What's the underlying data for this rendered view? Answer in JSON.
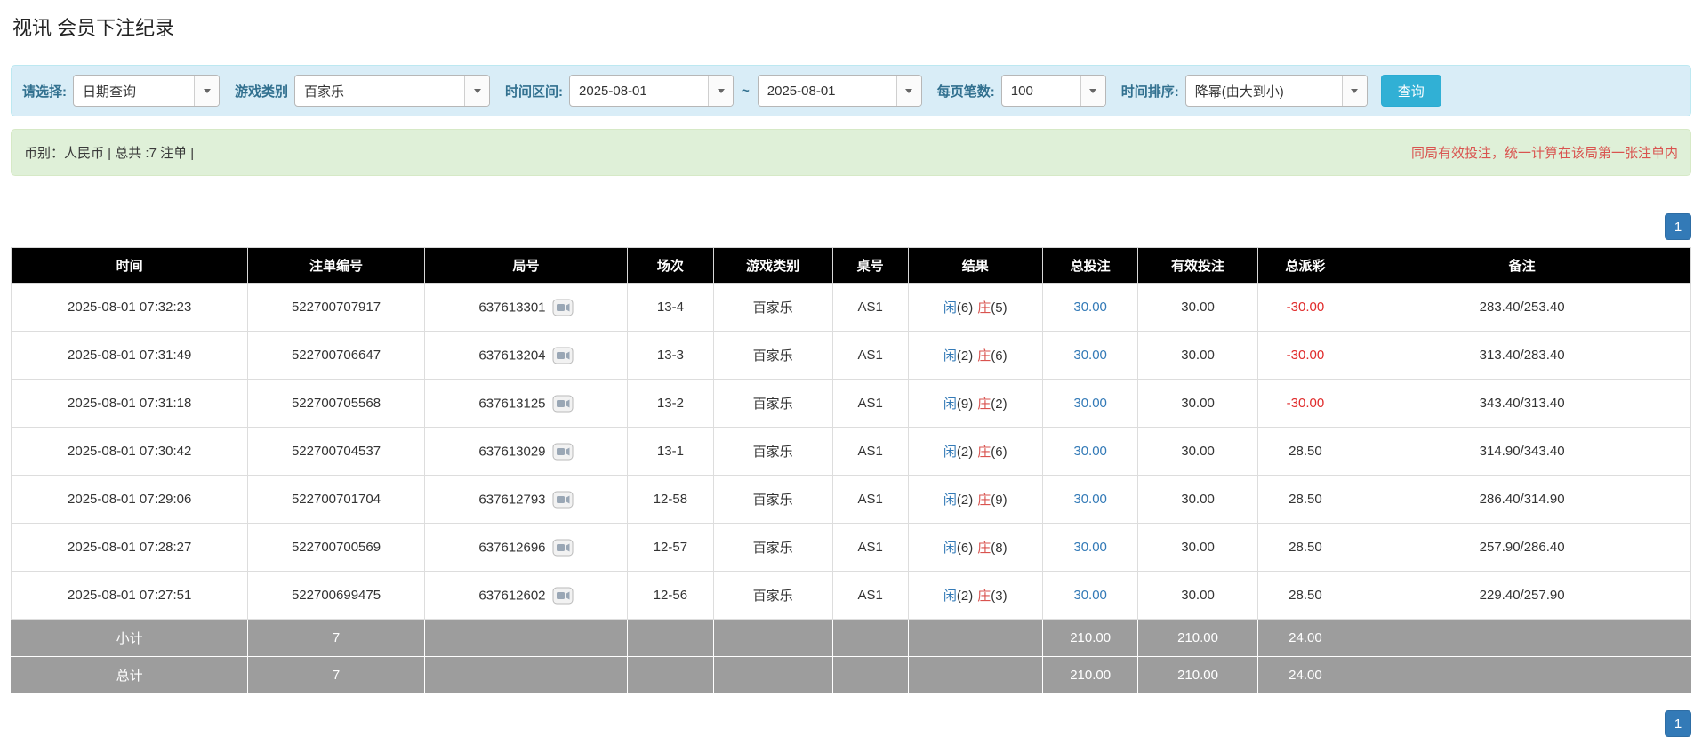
{
  "page": {
    "title": "视讯 会员下注纪录"
  },
  "colors": {
    "filter_bar_bg": "#d9edf7",
    "summary_bar_bg": "#dff0d8",
    "accent_blue": "#337ab7",
    "search_button_blue": "#31b0d5",
    "negative_red": "#e02b2b",
    "player_blue": "#337ab7",
    "banker_red": "#d9534f",
    "table_header_bg": "#000000",
    "total_row_bg": "#9d9d9d"
  },
  "icons": {
    "combo_caret": "caret-down",
    "round_replay": "video-replay"
  },
  "filters": {
    "select_label": "请选择:",
    "select_value": "日期查询",
    "game_label": "游戏类别",
    "game_value": "百家乐",
    "range_label": "时间区间:",
    "date_from": "2025-08-01",
    "range_separator": "~",
    "date_to": "2025-08-01",
    "page_size_label": "每页笔数:",
    "page_size_value": "100",
    "sort_label": "时间排序:",
    "sort_value": "降幂(由大到小)",
    "search_button": "查询"
  },
  "summary": {
    "left_text": "币别：人民币 | 总共 :7 注单 |",
    "right_text": "同局有效投注，统一计算在该局第一张注单内"
  },
  "pagination": {
    "current_page": "1"
  },
  "table": {
    "headers": [
      "时间",
      "注单编号",
      "局号",
      "场次",
      "游戏类别",
      "桌号",
      "结果",
      "总投注",
      "有效投注",
      "总派彩",
      "备注"
    ],
    "rows": [
      {
        "time": "2025-08-01 07:32:23",
        "bet_no": "522700707917",
        "round_no": "637613301",
        "session": "13-4",
        "game": "百家乐",
        "table_no": "AS1",
        "player_label": "闲",
        "player_value": "(6)",
        "banker_label": "庄",
        "banker_value": "(5)",
        "total_bet": "30.00",
        "valid_bet": "30.00",
        "payout": "-30.00",
        "note": "283.40/253.40"
      },
      {
        "time": "2025-08-01 07:31:49",
        "bet_no": "522700706647",
        "round_no": "637613204",
        "session": "13-3",
        "game": "百家乐",
        "table_no": "AS1",
        "player_label": "闲",
        "player_value": "(2)",
        "banker_label": "庄",
        "banker_value": "(6)",
        "total_bet": "30.00",
        "valid_bet": "30.00",
        "payout": "-30.00",
        "note": "313.40/283.40"
      },
      {
        "time": "2025-08-01 07:31:18",
        "bet_no": "522700705568",
        "round_no": "637613125",
        "session": "13-2",
        "game": "百家乐",
        "table_no": "AS1",
        "player_label": "闲",
        "player_value": "(9)",
        "banker_label": "庄",
        "banker_value": "(2)",
        "total_bet": "30.00",
        "valid_bet": "30.00",
        "payout": "-30.00",
        "note": "343.40/313.40"
      },
      {
        "time": "2025-08-01 07:30:42",
        "bet_no": "522700704537",
        "round_no": "637613029",
        "session": "13-1",
        "game": "百家乐",
        "table_no": "AS1",
        "player_label": "闲",
        "player_value": "(2)",
        "banker_label": "庄",
        "banker_value": "(6)",
        "total_bet": "30.00",
        "valid_bet": "30.00",
        "payout": "28.50",
        "note": "314.90/343.40"
      },
      {
        "time": "2025-08-01 07:29:06",
        "bet_no": "522700701704",
        "round_no": "637612793",
        "session": "12-58",
        "game": "百家乐",
        "table_no": "AS1",
        "player_label": "闲",
        "player_value": "(2)",
        "banker_label": "庄",
        "banker_value": "(9)",
        "total_bet": "30.00",
        "valid_bet": "30.00",
        "payout": "28.50",
        "note": "286.40/314.90"
      },
      {
        "time": "2025-08-01 07:28:27",
        "bet_no": "522700700569",
        "round_no": "637612696",
        "session": "12-57",
        "game": "百家乐",
        "table_no": "AS1",
        "player_label": "闲",
        "player_value": "(6)",
        "banker_label": "庄",
        "banker_value": "(8)",
        "total_bet": "30.00",
        "valid_bet": "30.00",
        "payout": "28.50",
        "note": "257.90/286.40"
      },
      {
        "time": "2025-08-01 07:27:51",
        "bet_no": "522700699475",
        "round_no": "637612602",
        "session": "12-56",
        "game": "百家乐",
        "table_no": "AS1",
        "player_label": "闲",
        "player_value": "(2)",
        "banker_label": "庄",
        "banker_value": "(3)",
        "total_bet": "30.00",
        "valid_bet": "30.00",
        "payout": "28.50",
        "note": "229.40/257.90"
      }
    ],
    "subtotal": {
      "label": "小计",
      "count": "7",
      "total_bet": "210.00",
      "valid_bet": "210.00",
      "payout": "24.00"
    },
    "grand_total": {
      "label": "总计",
      "count": "7",
      "total_bet": "210.00",
      "valid_bet": "210.00",
      "payout": "24.00"
    }
  }
}
